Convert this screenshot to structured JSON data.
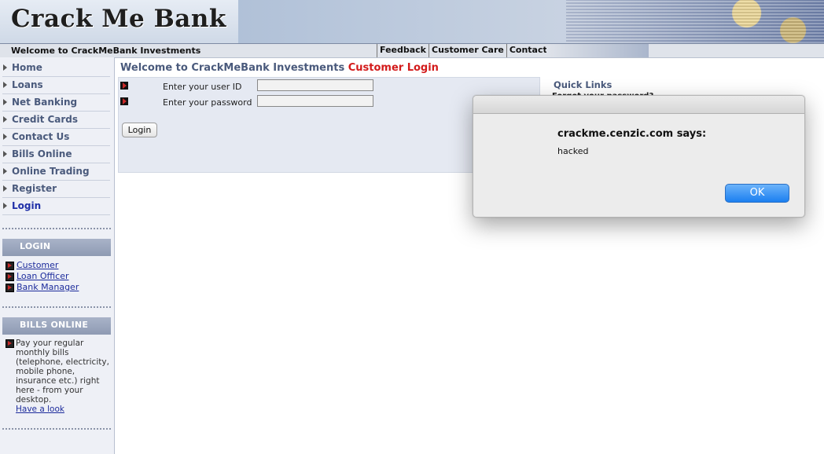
{
  "header": {
    "logo": "Crack Me Bank",
    "welcome": "Welcome to CrackMeBank Investments",
    "top_links": [
      "Feedback",
      "Customer Care",
      "Contact"
    ]
  },
  "sidebar": {
    "items": [
      {
        "label": "Home"
      },
      {
        "label": "Loans"
      },
      {
        "label": "Net Banking"
      },
      {
        "label": "Credit Cards"
      },
      {
        "label": "Contact Us"
      },
      {
        "label": "Bills Online"
      },
      {
        "label": "Online Trading"
      },
      {
        "label": "Register"
      },
      {
        "label": "Login"
      }
    ],
    "login_section": {
      "title": "LOGIN",
      "links": [
        "Customer",
        "Loan Officer",
        "Bank Manager"
      ]
    },
    "bills_section": {
      "title": "BILLS ONLINE",
      "text": "Pay your regular monthly bills (telephone, electricity, mobile phone, insurance etc.) right here - from your desktop.",
      "link": "Have a look"
    }
  },
  "main": {
    "title_prefix": "Welcome to CrackMeBank Investments",
    "title_highlight": "Customer Login",
    "user_label": "Enter your user ID",
    "user_value": "",
    "password_label": "Enter your password",
    "password_value": "",
    "login_button": "Login",
    "quick_links_title": "Quick Links",
    "quick_links_partial": "Forgot your password?"
  },
  "dialog": {
    "title": "crackme.cenzic.com says:",
    "message": "hacked",
    "ok_label": "OK"
  },
  "colors": {
    "nav_text": "#4a5a7c",
    "accent_red": "#d31b1b",
    "ok_blue": "#1b7ff0"
  }
}
